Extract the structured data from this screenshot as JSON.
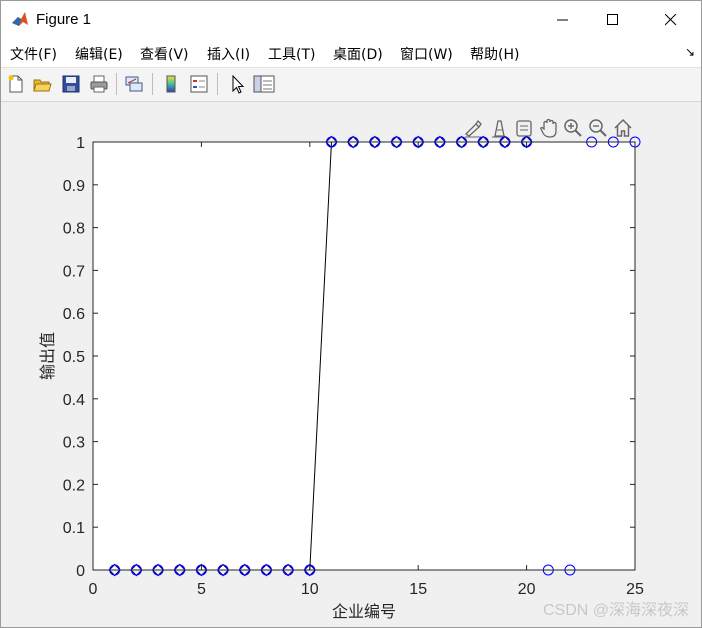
{
  "window": {
    "title": "Figure 1"
  },
  "menu": [
    {
      "label": "文件(F)"
    },
    {
      "label": "编辑(E)"
    },
    {
      "label": "查看(V)"
    },
    {
      "label": "插入(I)"
    },
    {
      "label": "工具(T)"
    },
    {
      "label": "桌面(D)"
    },
    {
      "label": "窗口(W)"
    },
    {
      "label": "帮助(H)"
    }
  ],
  "toolbar": [
    "new-figure-icon",
    "open-file-icon",
    "save-icon",
    "print-icon",
    "link-plot-icon",
    "colorbar-icon",
    "legend-icon",
    "select-cursor-icon",
    "property-inspector-icon"
  ],
  "axes_toolbar": [
    "brush-icon",
    "data-tips-icon",
    "restore-view-icon",
    "pan-icon",
    "zoom-in-icon",
    "zoom-out-icon",
    "home-icon"
  ],
  "watermark": "CSDN @深海深夜深",
  "chart_data": {
    "type": "line",
    "title": "",
    "xlabel": "企业编号",
    "ylabel": "输出值",
    "xlim": [
      0,
      25
    ],
    "ylim": [
      0,
      1
    ],
    "xticks": [
      0,
      5,
      10,
      15,
      20,
      25
    ],
    "yticks": [
      0,
      0.1,
      0.2,
      0.3,
      0.4,
      0.5,
      0.6,
      0.7,
      0.8,
      0.9,
      1
    ],
    "grid": false,
    "series": [
      {
        "marker": "diamond",
        "line": "solid",
        "color": "#000000",
        "marker_color": "#00008b",
        "x": [
          1,
          2,
          3,
          4,
          5,
          6,
          7,
          8,
          9,
          10,
          11,
          12,
          13,
          14,
          15,
          16,
          17,
          18,
          19,
          20
        ],
        "y": [
          0,
          0,
          0,
          0,
          0,
          0,
          0,
          0,
          0,
          0,
          1,
          1,
          1,
          1,
          1,
          1,
          1,
          1,
          1,
          1
        ]
      },
      {
        "marker": "circle",
        "line": "none",
        "color": "#0000ff",
        "x": [
          1,
          2,
          3,
          4,
          5,
          6,
          7,
          8,
          9,
          10,
          11,
          12,
          13,
          14,
          15,
          16,
          17,
          18,
          19,
          20,
          21,
          22,
          23,
          24,
          25
        ],
        "y": [
          0,
          0,
          0,
          0,
          0,
          0,
          0,
          0,
          0,
          0,
          1,
          1,
          1,
          1,
          1,
          1,
          1,
          1,
          1,
          1,
          0,
          0,
          1,
          1,
          1
        ]
      }
    ]
  }
}
